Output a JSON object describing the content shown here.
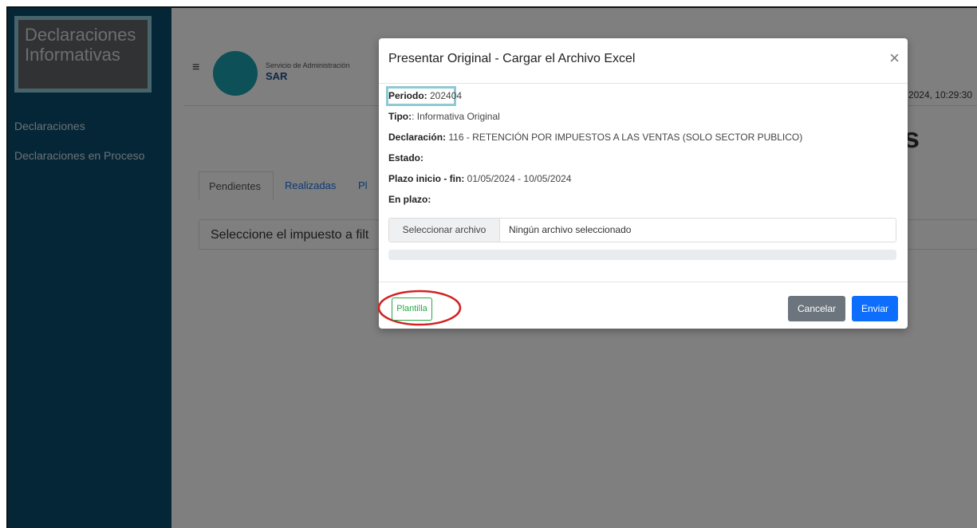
{
  "sidebar": {
    "brand": [
      "Declaraciones",
      "Informativas"
    ],
    "items": [
      {
        "label": "Declaraciones"
      },
      {
        "label": "Declaraciones en Proceso"
      }
    ]
  },
  "header": {
    "menu_icon": "hamburger-icon",
    "logo_text": "Servicio de Administración",
    "logo_sar": "SAR",
    "datetime": "2024, 10:29:30"
  },
  "main": {
    "title_tail": "s",
    "tabs": [
      {
        "label": "Pendientes"
      },
      {
        "label": "Realizadas"
      },
      {
        "label": "Pl"
      }
    ],
    "filter_text": "Seleccione el impuesto a filt"
  },
  "modal": {
    "title": "Presentar Original - Cargar el Archivo Excel",
    "close_icon": "close-icon",
    "fields": [
      {
        "label": "Periodo:",
        "value": " 202404"
      },
      {
        "label": "Tipo:",
        "value": ": Informativa Original"
      },
      {
        "label": "Declaración:",
        "value": " 116 - RETENCIÓN POR IMPUESTOS A LAS VENTAS (SOLO SECTOR PUBLICO)"
      },
      {
        "label": "Estado:",
        "value": ""
      },
      {
        "label": "Plazo inicio - fin:",
        "value": " 01/05/2024 - 10/05/2024"
      },
      {
        "label": "En plazo:",
        "value": ""
      }
    ],
    "file_button": "Seleccionar archivo",
    "file_status": "Ningún archivo seleccionado",
    "progress": 0,
    "buttons": {
      "plantilla": "Plantilla",
      "cancel": "Cancelar",
      "send": "Enviar"
    }
  },
  "colors": {
    "sidebar": "#0a4d6e",
    "highlight": "#8ec9d4",
    "success": "#28a745",
    "primary": "#0d6efd",
    "secondary": "#6c757d",
    "annotation": "#d22222"
  }
}
